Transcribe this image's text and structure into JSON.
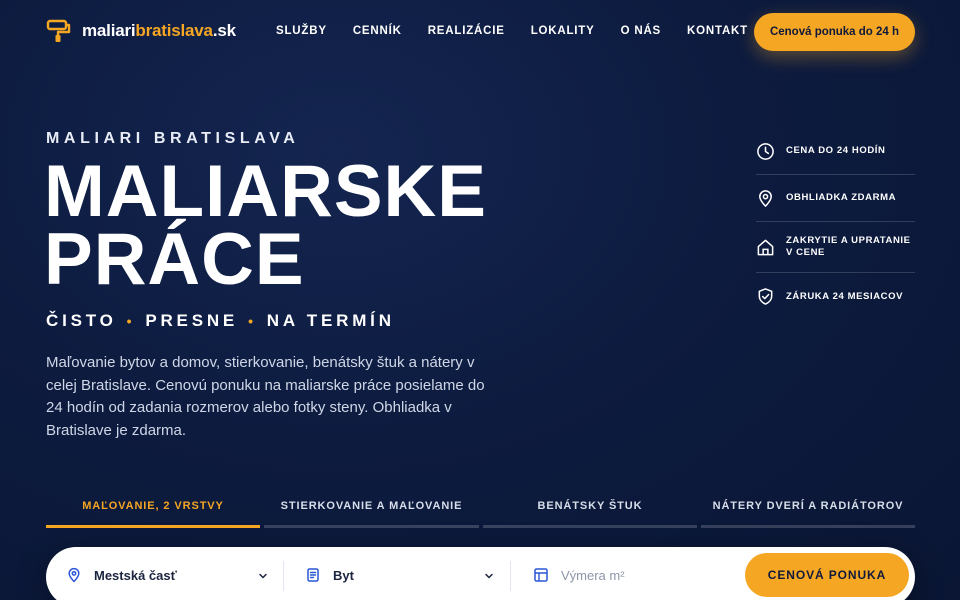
{
  "header": {
    "logo_main": "maliari",
    "logo_accent": "bratislava",
    "logo_tld": ".sk",
    "menu": [
      "SLUŽBY",
      "CENNÍK",
      "REALIZÁCIE",
      "LOKALITY",
      "O NÁS",
      "KONTAKT"
    ],
    "cta_label": "Cenová ponuka do 24 h"
  },
  "hero": {
    "eyebrow": "MALIARI BRATISLAVA",
    "title_line1": "MALIARSKE",
    "title_line2": "PRÁCE",
    "tagline": [
      "ČISTO",
      "PRESNE",
      "NA TERMÍN"
    ],
    "tagline_separator": "•",
    "description": "Maľovanie bytov a domov, stierkovanie, benátsky štuk a nátery v celej Bratislave. Cenovú ponuku na maliarske práce posielame do 24 hodín od zadania rozmerov alebo fotky steny. Obhliadka v Bratislave je zdarma."
  },
  "features": [
    {
      "icon": "clock-icon",
      "label": "CENA DO 24 HODÍN"
    },
    {
      "icon": "location-pin-icon",
      "label": "OBHLIADKA ZDARMA"
    },
    {
      "icon": "house-icon",
      "label": "ZAKRYTIE A UPRATANIE V CENE"
    },
    {
      "icon": "shield-check-icon",
      "label": "ZÁRUKA 24 MESIACOV"
    }
  ],
  "tabs": [
    {
      "label": "MAĽOVANIE, 2 VRSTVY",
      "active": true
    },
    {
      "label": "STIERKOVANIE A MAĽOVANIE",
      "active": false
    },
    {
      "label": "BENÁTSKY ŠTUK",
      "active": false
    },
    {
      "label": "NÁTERY DVERÍ A RADIÁTOROV",
      "active": false
    }
  ],
  "form": {
    "district_label": "Mestská časť",
    "property_label": "Byt",
    "area_placeholder": "Výmera m²",
    "submit_label": "CENOVÁ PONUKA"
  },
  "colors": {
    "accent": "#f5a623",
    "background": "#0c1a3c",
    "text": "#ffffff"
  }
}
